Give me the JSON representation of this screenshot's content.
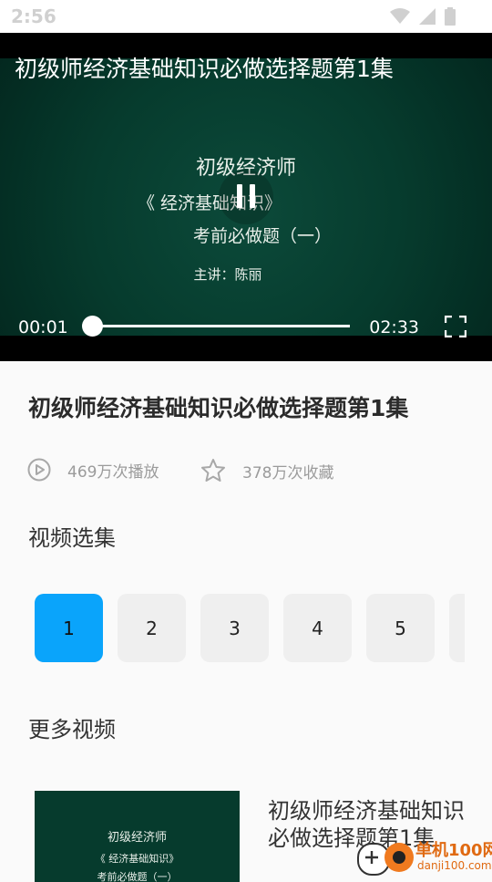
{
  "status_bar": {
    "time": "2:56",
    "icons": [
      "wifi-icon",
      "cell-signal-icon",
      "battery-icon"
    ]
  },
  "player": {
    "title": "初级师经济基础知识必做选择题第1集",
    "slide": {
      "line1": "初级经济师",
      "line2": "《 经济基础知识》",
      "line3": "考前必做题（一）",
      "line4": "主讲：陈丽"
    },
    "current_time": "00:01",
    "total_time": "02:33",
    "progress": 0.01,
    "state": "playing"
  },
  "video": {
    "title": "初级师经济基础知识必做选择题第1集",
    "plays": "469万次播放",
    "favorites": "378万次收藏"
  },
  "episodes": {
    "heading": "视频选集",
    "items": [
      "1",
      "2",
      "3",
      "4",
      "5",
      ""
    ],
    "selected": "1"
  },
  "more": {
    "heading": "更多视频",
    "items": [
      {
        "thumb_line1": "初级经济师",
        "thumb_line2": "《 经济基础知识》",
        "thumb_line3": "考前必做题（一）",
        "title": "初级师经济基础知识必做选择题第1集"
      }
    ]
  },
  "watermark": {
    "line1": "单机100网",
    "line2": "danji100.com"
  },
  "colors": {
    "accent": "#0aa4fb",
    "slide_bg": "#063b2d"
  }
}
